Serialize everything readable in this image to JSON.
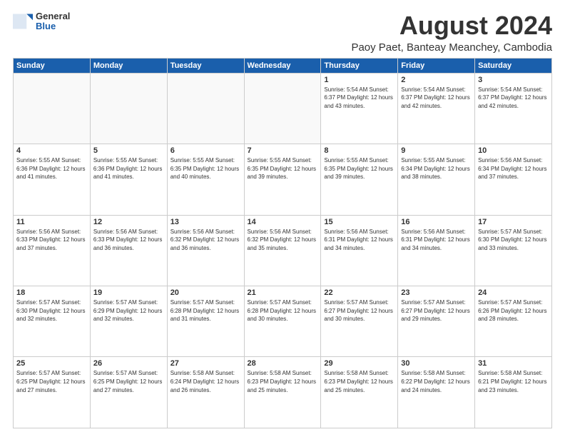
{
  "logo": {
    "general": "General",
    "blue": "Blue"
  },
  "header": {
    "month": "August 2024",
    "location": "Paoy Paet, Banteay Meanchey, Cambodia"
  },
  "weekdays": [
    "Sunday",
    "Monday",
    "Tuesday",
    "Wednesday",
    "Thursday",
    "Friday",
    "Saturday"
  ],
  "weeks": [
    [
      {
        "day": "",
        "info": ""
      },
      {
        "day": "",
        "info": ""
      },
      {
        "day": "",
        "info": ""
      },
      {
        "day": "",
        "info": ""
      },
      {
        "day": "1",
        "info": "Sunrise: 5:54 AM\nSunset: 6:37 PM\nDaylight: 12 hours\nand 43 minutes."
      },
      {
        "day": "2",
        "info": "Sunrise: 5:54 AM\nSunset: 6:37 PM\nDaylight: 12 hours\nand 42 minutes."
      },
      {
        "day": "3",
        "info": "Sunrise: 5:54 AM\nSunset: 6:37 PM\nDaylight: 12 hours\nand 42 minutes."
      }
    ],
    [
      {
        "day": "4",
        "info": "Sunrise: 5:55 AM\nSunset: 6:36 PM\nDaylight: 12 hours\nand 41 minutes."
      },
      {
        "day": "5",
        "info": "Sunrise: 5:55 AM\nSunset: 6:36 PM\nDaylight: 12 hours\nand 41 minutes."
      },
      {
        "day": "6",
        "info": "Sunrise: 5:55 AM\nSunset: 6:35 PM\nDaylight: 12 hours\nand 40 minutes."
      },
      {
        "day": "7",
        "info": "Sunrise: 5:55 AM\nSunset: 6:35 PM\nDaylight: 12 hours\nand 39 minutes."
      },
      {
        "day": "8",
        "info": "Sunrise: 5:55 AM\nSunset: 6:35 PM\nDaylight: 12 hours\nand 39 minutes."
      },
      {
        "day": "9",
        "info": "Sunrise: 5:55 AM\nSunset: 6:34 PM\nDaylight: 12 hours\nand 38 minutes."
      },
      {
        "day": "10",
        "info": "Sunrise: 5:56 AM\nSunset: 6:34 PM\nDaylight: 12 hours\nand 37 minutes."
      }
    ],
    [
      {
        "day": "11",
        "info": "Sunrise: 5:56 AM\nSunset: 6:33 PM\nDaylight: 12 hours\nand 37 minutes."
      },
      {
        "day": "12",
        "info": "Sunrise: 5:56 AM\nSunset: 6:33 PM\nDaylight: 12 hours\nand 36 minutes."
      },
      {
        "day": "13",
        "info": "Sunrise: 5:56 AM\nSunset: 6:32 PM\nDaylight: 12 hours\nand 36 minutes."
      },
      {
        "day": "14",
        "info": "Sunrise: 5:56 AM\nSunset: 6:32 PM\nDaylight: 12 hours\nand 35 minutes."
      },
      {
        "day": "15",
        "info": "Sunrise: 5:56 AM\nSunset: 6:31 PM\nDaylight: 12 hours\nand 34 minutes."
      },
      {
        "day": "16",
        "info": "Sunrise: 5:56 AM\nSunset: 6:31 PM\nDaylight: 12 hours\nand 34 minutes."
      },
      {
        "day": "17",
        "info": "Sunrise: 5:57 AM\nSunset: 6:30 PM\nDaylight: 12 hours\nand 33 minutes."
      }
    ],
    [
      {
        "day": "18",
        "info": "Sunrise: 5:57 AM\nSunset: 6:30 PM\nDaylight: 12 hours\nand 32 minutes."
      },
      {
        "day": "19",
        "info": "Sunrise: 5:57 AM\nSunset: 6:29 PM\nDaylight: 12 hours\nand 32 minutes."
      },
      {
        "day": "20",
        "info": "Sunrise: 5:57 AM\nSunset: 6:28 PM\nDaylight: 12 hours\nand 31 minutes."
      },
      {
        "day": "21",
        "info": "Sunrise: 5:57 AM\nSunset: 6:28 PM\nDaylight: 12 hours\nand 30 minutes."
      },
      {
        "day": "22",
        "info": "Sunrise: 5:57 AM\nSunset: 6:27 PM\nDaylight: 12 hours\nand 30 minutes."
      },
      {
        "day": "23",
        "info": "Sunrise: 5:57 AM\nSunset: 6:27 PM\nDaylight: 12 hours\nand 29 minutes."
      },
      {
        "day": "24",
        "info": "Sunrise: 5:57 AM\nSunset: 6:26 PM\nDaylight: 12 hours\nand 28 minutes."
      }
    ],
    [
      {
        "day": "25",
        "info": "Sunrise: 5:57 AM\nSunset: 6:25 PM\nDaylight: 12 hours\nand 27 minutes."
      },
      {
        "day": "26",
        "info": "Sunrise: 5:57 AM\nSunset: 6:25 PM\nDaylight: 12 hours\nand 27 minutes."
      },
      {
        "day": "27",
        "info": "Sunrise: 5:58 AM\nSunset: 6:24 PM\nDaylight: 12 hours\nand 26 minutes."
      },
      {
        "day": "28",
        "info": "Sunrise: 5:58 AM\nSunset: 6:23 PM\nDaylight: 12 hours\nand 25 minutes."
      },
      {
        "day": "29",
        "info": "Sunrise: 5:58 AM\nSunset: 6:23 PM\nDaylight: 12 hours\nand 25 minutes."
      },
      {
        "day": "30",
        "info": "Sunrise: 5:58 AM\nSunset: 6:22 PM\nDaylight: 12 hours\nand 24 minutes."
      },
      {
        "day": "31",
        "info": "Sunrise: 5:58 AM\nSunset: 6:21 PM\nDaylight: 12 hours\nand 23 minutes."
      }
    ]
  ]
}
